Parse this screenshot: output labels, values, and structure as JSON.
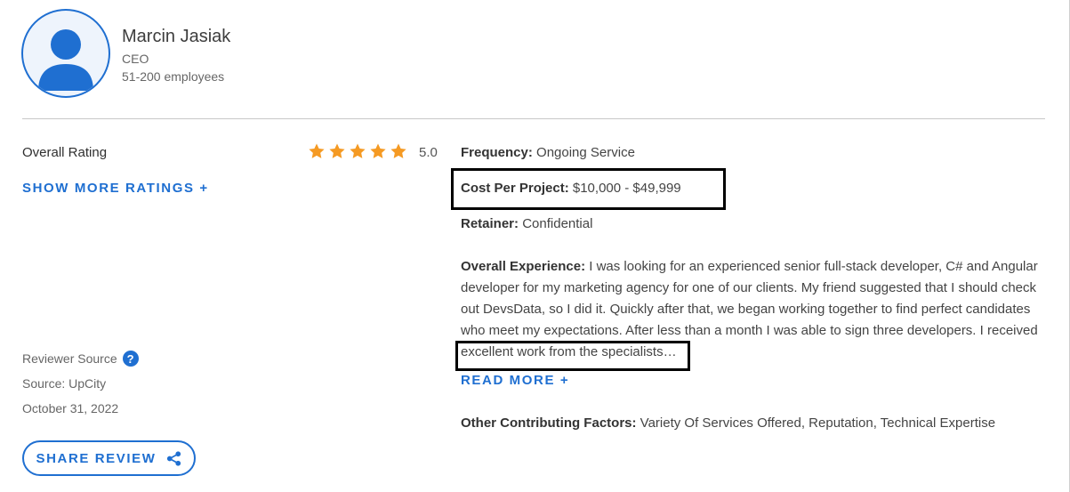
{
  "reviewer": {
    "name": "Marcin Jasiak",
    "title": "CEO",
    "company_size": "51-200 employees"
  },
  "ratings": {
    "overall_label": "Overall Rating",
    "stars": 5,
    "score": "5.0",
    "show_more_label": "SHOW MORE RATINGS +"
  },
  "project": {
    "frequency_label": "Frequency:",
    "frequency_value": "Ongoing Service",
    "cost_label": "Cost Per Project:",
    "cost_value": "$10,000 - $49,999",
    "retainer_label": "Retainer:",
    "retainer_value": "Confidential"
  },
  "experience": {
    "label": "Overall Experience:",
    "text_before": "I was looking for an experienced senior full-stack developer, C# and Angular developer for my marketing agency for one of our clients. My friend suggested that I should check out DevsData, so I did it. Quickly after that, we began working together to find perfect candidates who meet my expectations. After less than a month I was able to sign three developers. I received excellent work from the specialists…",
    "read_more_label": "READ MORE +"
  },
  "factors": {
    "label": "Other Contributing Factors:",
    "value": "Variety Of Services Offered, Reputation, Technical Expertise"
  },
  "source": {
    "reviewer_source_label": "Reviewer Source",
    "help_glyph": "?",
    "source_text": "Source: UpCity",
    "date": "October 31, 2022"
  },
  "share": {
    "label": "SHARE REVIEW"
  },
  "colors": {
    "accent": "#1f6fd1",
    "star": "#f59a23",
    "annotation_box": "#000000"
  }
}
